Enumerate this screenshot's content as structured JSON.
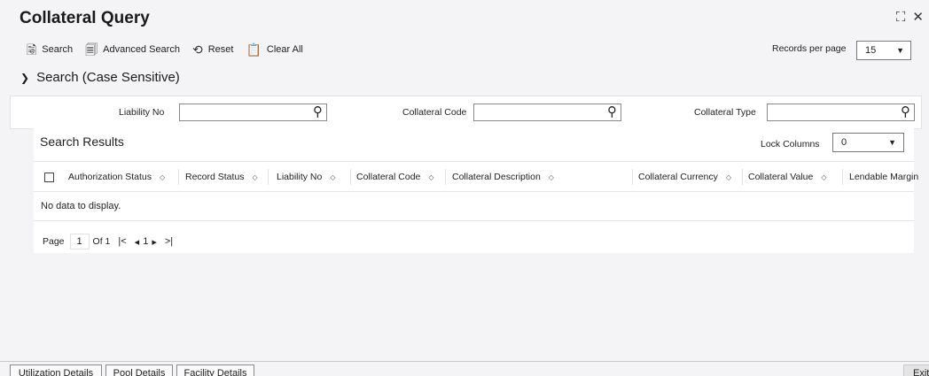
{
  "window": {
    "title": "Collateral Query",
    "maximize_glyph": "⛶",
    "close_glyph": "✕"
  },
  "toolbar": {
    "search": {
      "label": "Search",
      "icon": "search-doc-icon",
      "glyph": "🗟"
    },
    "advanced": {
      "label": "Advanced Search",
      "icon": "advanced-search-icon",
      "glyph": "🗐"
    },
    "reset": {
      "label": "Reset",
      "icon": "reset-icon",
      "glyph": "⟲"
    },
    "clear": {
      "label": "Clear All",
      "icon": "clear-all-icon",
      "glyph": "📋"
    },
    "records_per_page_label": "Records per page",
    "records_per_page_value": "15"
  },
  "search_section": {
    "title": "Search (Case Sensitive)",
    "fields": [
      {
        "label": "Liability No",
        "value": ""
      },
      {
        "label": "Collateral Code",
        "value": ""
      },
      {
        "label": "Collateral Type",
        "value": ""
      }
    ]
  },
  "results": {
    "title": "Search Results",
    "lock_columns_label": "Lock Columns",
    "lock_columns_value": "0",
    "columns": [
      "Authorization Status",
      "Record Status",
      "Liability No",
      "Collateral Code",
      "Collateral Description",
      "Collateral Currency",
      "Collateral Value",
      "Lendable Margin"
    ],
    "empty_message": "No data to display.",
    "pagination": {
      "page_label": "Page",
      "page_value": "1",
      "of_label": "Of 1",
      "first": "|<",
      "prev": "◂",
      "current": "1",
      "next": "▸",
      "last": ">|"
    }
  },
  "bottom_tabs": [
    "Utilization Details",
    "Pool Details",
    "Facility Details"
  ],
  "exit_label": "Exit",
  "colors": {
    "background": "#f4f4f6",
    "panel": "#ffffff",
    "text": "#1f1f1f",
    "border": "#888888"
  }
}
